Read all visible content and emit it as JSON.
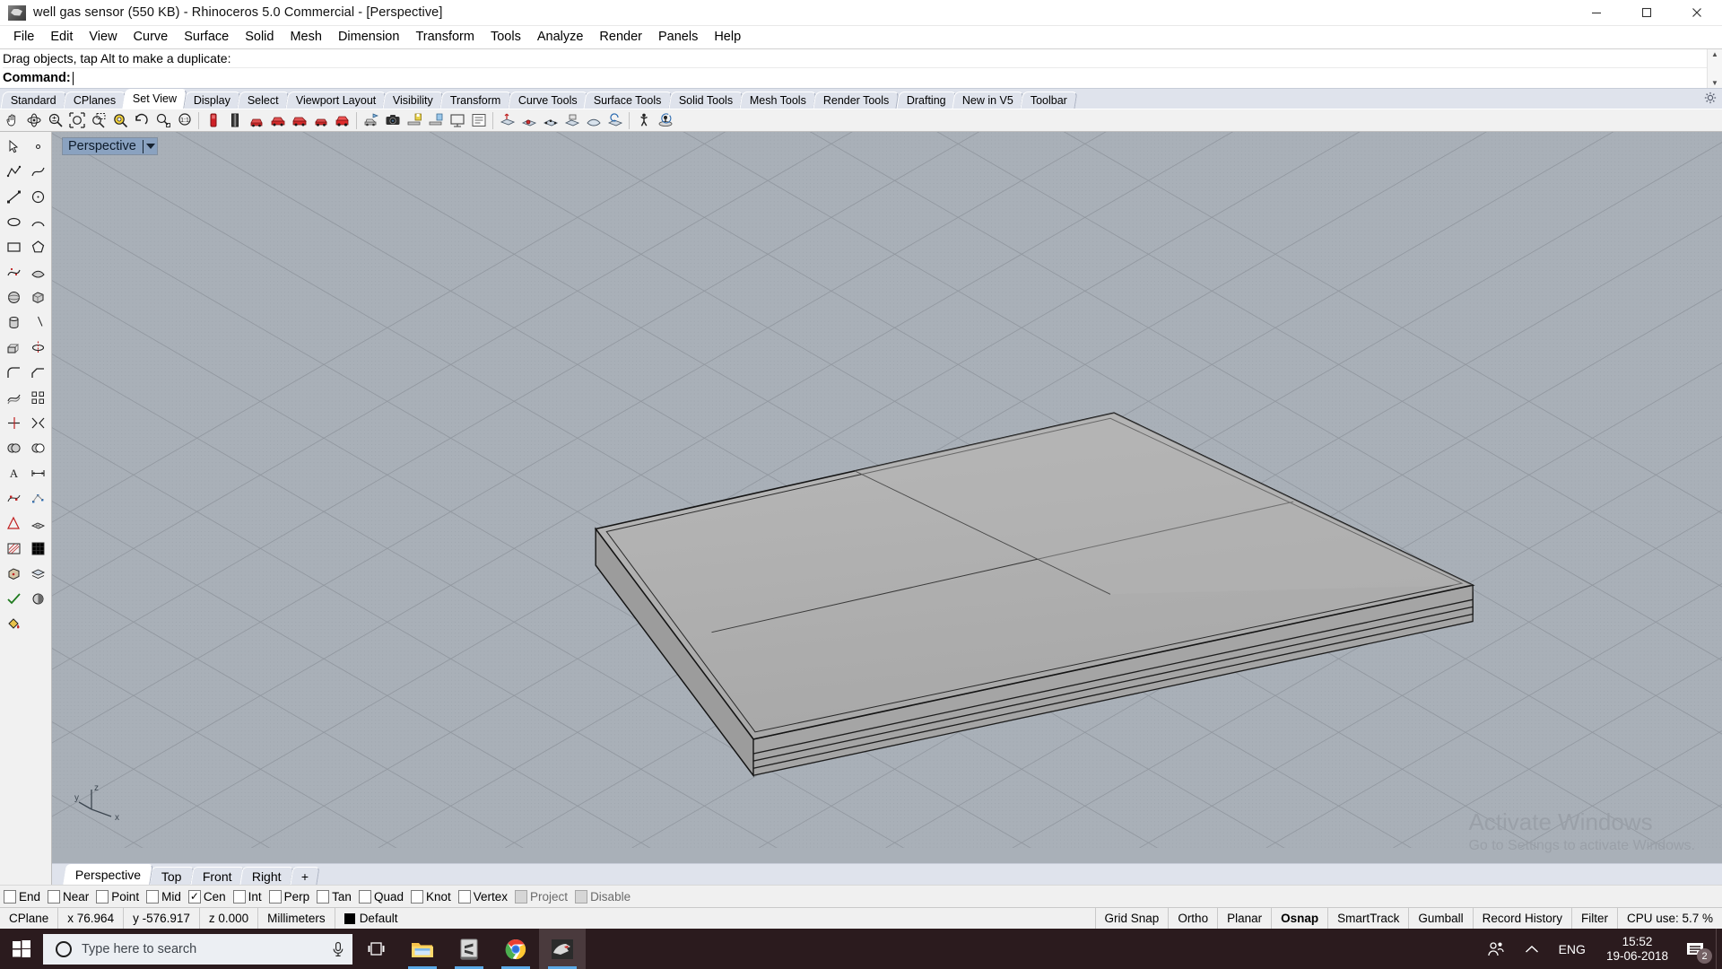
{
  "window": {
    "title": "well gas sensor (550 KB) - Rhinoceros 5.0 Commercial - [Perspective]",
    "app_icon": "rhino-icon",
    "minimize": "minimize-button",
    "maximize": "maximize-button",
    "close": "close-button"
  },
  "menubar": {
    "items": [
      "File",
      "Edit",
      "View",
      "Curve",
      "Surface",
      "Solid",
      "Mesh",
      "Dimension",
      "Transform",
      "Tools",
      "Analyze",
      "Render",
      "Panels",
      "Help"
    ]
  },
  "command": {
    "history": "Drag objects, tap Alt to make a duplicate:",
    "label": "Command:",
    "value": "",
    "placeholder": ""
  },
  "toolbar_tabs": {
    "active": "Set View",
    "items": [
      "Standard",
      "CPlanes",
      "Set View",
      "Display",
      "Select",
      "Viewport Layout",
      "Visibility",
      "Transform",
      "Curve Tools",
      "Surface Tools",
      "Solid Tools",
      "Mesh Tools",
      "Render Tools",
      "Drafting",
      "New in V5",
      "Toolbar"
    ]
  },
  "icon_toolbar": {
    "buttons": [
      "pan-view-icon",
      "rotate-view-icon",
      "zoom-in-out-icon",
      "zoom-extents-icon",
      "zoom-window-icon",
      "zoom-selected-icon",
      "undo-view-change-icon",
      "zoom-target-icon",
      "zoom-1to1-icon",
      "set-view-perspective-icon",
      "set-view-two-point-icon",
      "set-view-top-icon",
      "set-view-bottom-icon",
      "set-view-front-icon",
      "set-view-back-icon",
      "set-view-right-icon",
      "named-view-icon",
      "camera-icon",
      "save-view-icon",
      "restore-view-icon",
      "place-view-icon",
      "view-properties-icon",
      "set-cplane-icon",
      "cplane-origin-icon",
      "cplane-3point-icon",
      "cplane-object-icon",
      "cplane-surface-icon",
      "cplane-elevation-icon",
      "cplane-rotate-icon",
      "walkabout-icon",
      "turntable-icon"
    ]
  },
  "sidebar": {
    "buttons": [
      "select-object-icon",
      "select-point-icon",
      "polyline-icon",
      "curve-icon",
      "line-segments-icon",
      "circle-icon",
      "ellipse-icon",
      "arc-icon",
      "rectangle-icon",
      "polygon-icon",
      "freeform-curve-icon",
      "surface-from-curves-icon",
      "sphere-icon",
      "box-icon",
      "cylinder-icon",
      "cone-icon",
      "extrude-icon",
      "revolve-icon",
      "fillet-icon",
      "chamfer-icon",
      "offset-icon",
      "array-icon",
      "trim-icon",
      "split-icon",
      "boolean-union-icon",
      "boolean-difference-icon",
      "text-icon",
      "dimension-icon",
      "point-editing-icon",
      "control-points-icon",
      "analyze-icon",
      "mesh-tools-icon",
      "hatch-icon",
      "grid-icon",
      "block-icon",
      "layer-icon",
      "check-object-icon",
      "render-icon",
      "paint-bucket-icon"
    ]
  },
  "viewport": {
    "name": "Perspective",
    "dropdown": "chevron-down-icon",
    "axis_labels": {
      "x": "x",
      "y": "y",
      "z": "z"
    },
    "background_color": "#a9b0b8",
    "grid_color": "#8d949c",
    "object": {
      "description": "flat rectangular multi-layer plate (PCB / enclosure lid) in shaded view, subdivided into four quadrants",
      "fill_color": "#b0b0b0",
      "edge_color": "#1a1a1a"
    },
    "watermark": {
      "line1": "Activate Windows",
      "line2": "Go to Settings to activate Windows."
    }
  },
  "viewport_tabs": {
    "active": "Perspective",
    "items": [
      "Perspective",
      "Top",
      "Front",
      "Right"
    ],
    "add_label": "+"
  },
  "osnap": {
    "items": [
      {
        "label": "End",
        "checked": false,
        "disabled": false
      },
      {
        "label": "Near",
        "checked": false,
        "disabled": false
      },
      {
        "label": "Point",
        "checked": false,
        "disabled": false
      },
      {
        "label": "Mid",
        "checked": false,
        "disabled": false
      },
      {
        "label": "Cen",
        "checked": true,
        "disabled": false
      },
      {
        "label": "Int",
        "checked": false,
        "disabled": false
      },
      {
        "label": "Perp",
        "checked": false,
        "disabled": false
      },
      {
        "label": "Tan",
        "checked": false,
        "disabled": false
      },
      {
        "label": "Quad",
        "checked": false,
        "disabled": false
      },
      {
        "label": "Knot",
        "checked": false,
        "disabled": false
      },
      {
        "label": "Vertex",
        "checked": false,
        "disabled": false
      },
      {
        "label": "Project",
        "checked": false,
        "disabled": true
      },
      {
        "label": "Disable",
        "checked": false,
        "disabled": true
      }
    ],
    "check_glyph": "✓"
  },
  "statusbar": {
    "cplane": "CPlane",
    "x": "x 76.964",
    "y": "y -576.917",
    "z": "z 0.000",
    "units": "Millimeters",
    "layer": "Default",
    "layer_color": "#000000",
    "toggles": [
      {
        "label": "Grid Snap",
        "active": false
      },
      {
        "label": "Ortho",
        "active": false
      },
      {
        "label": "Planar",
        "active": false
      },
      {
        "label": "Osnap",
        "active": true
      },
      {
        "label": "SmartTrack",
        "active": false
      },
      {
        "label": "Gumball",
        "active": false
      },
      {
        "label": "Record History",
        "active": false
      },
      {
        "label": "Filter",
        "active": false
      }
    ],
    "cpu": "CPU use: 5.7 %"
  },
  "taskbar": {
    "start": "windows-start-icon",
    "search_placeholder": "Type here to search",
    "search_value": "",
    "cortana_icon": "cortana-circle-icon",
    "mic_icon": "microphone-icon",
    "taskview_icon": "task-view-icon",
    "apps": [
      {
        "name": "file-explorer",
        "running": true,
        "active": false
      },
      {
        "name": "sublime-text",
        "running": true,
        "active": false
      },
      {
        "name": "google-chrome",
        "running": true,
        "active": false
      },
      {
        "name": "rhinoceros",
        "running": true,
        "active": true
      }
    ],
    "tray": {
      "people_icon": "people-icon",
      "chevron_icon": "show-hidden-icons-chevron",
      "language": "ENG",
      "time": "15:52",
      "date": "19-06-2018",
      "notification_icon": "action-center-icon",
      "notification_count": "2"
    }
  }
}
